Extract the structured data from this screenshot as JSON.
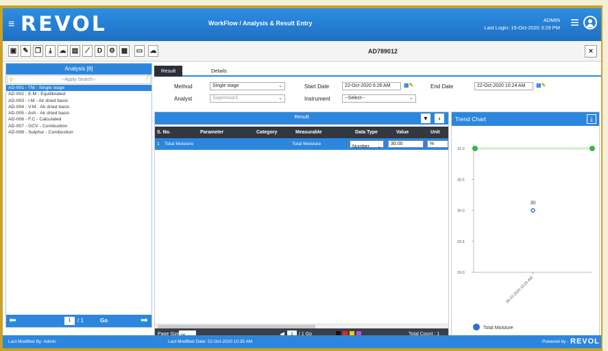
{
  "header": {
    "logo": "REVOL",
    "menu_icon": "hamburger-icon",
    "breadcrumb": "WorkFlow / Analysis & Result Entry",
    "user": "ADMIN",
    "last_login": "Last Login: 15-Oct-2020 3:29 PM"
  },
  "toolbar": {
    "icons": [
      "save-icon",
      "edit-icon",
      "copy-icon",
      "download-icon",
      "upload-icon",
      "document-icon",
      "chart-icon",
      "d-icon",
      "group-icon",
      "calculator-icon",
      "blank-doc-icon",
      "upload-cloud-icon"
    ],
    "d_label": "D",
    "sample_code": "AD789012",
    "close_label": "×"
  },
  "analysis_panel": {
    "title": "Analysis [8]",
    "search_placeholder": "--Apply Search--",
    "items": [
      "AD-001 - TM - Single stage",
      "AD-002 - E.M - Equilibrated",
      "AD-003 - I.M - Air dried basis",
      "AD-004 - V.M - Air dried basis",
      "AD-005 - Ash - Air dried basis",
      "AD-006 - F.C - Calculated",
      "AD-007 - GCV - Combustion",
      "AD-008 - Sulphur - Combustion"
    ],
    "selected_index": 0,
    "page": "1",
    "page_total": "/ 1",
    "go_label": "Go"
  },
  "tabs": [
    {
      "label": "Result",
      "active": true
    },
    {
      "label": "Details",
      "active": false
    }
  ],
  "form": {
    "method_label": "Method",
    "method_value": "Single stage",
    "analyst_label": "Analyst",
    "analyst_value": "Supervisor1",
    "start_label": "Start Date",
    "start_value": "22-Oct-2020 6:26 AM",
    "end_label": "End Date",
    "end_value": "22-Oct-2020 10:24 AM",
    "instrument_label": "Instrument",
    "instrument_value": "--Select--"
  },
  "result_grid": {
    "title": "Result",
    "columns": [
      "S. No.",
      "Parameter",
      "Category",
      "Measurable",
      "Data Type",
      "Value",
      "Unit"
    ],
    "rows": [
      {
        "sno": "1",
        "parameter": "Total Moisture",
        "category": "",
        "measurable": "Total Moisture",
        "data_type": "Number",
        "value": "30.00",
        "unit": "%"
      }
    ],
    "page_size_label": "Page Size :",
    "page_size": "25",
    "page": "1",
    "page_of": "/ 1 Go",
    "total_count": "Total Count : 1",
    "color_swatches": [
      "#111111",
      "#e8261c",
      "#ffcc00",
      "#c04ad8"
    ]
  },
  "trend_chart": {
    "title": "Trend Chart",
    "chart_data": {
      "type": "line",
      "ylim": [
        29.0,
        31.0
      ],
      "y_ticks": [
        "31.0",
        "30.5",
        "30.0",
        "29.5",
        "29.0"
      ],
      "categories": [
        "06-22-2020 10:24 AM"
      ],
      "series": [
        {
          "name": "Total Moisture",
          "values": [
            30
          ],
          "color": "#2d6fd0"
        }
      ],
      "point_label": "30",
      "limit_line": {
        "value": 31.0,
        "color": "#3ab54a"
      },
      "legend_position": "bottom-left"
    }
  },
  "statusbar": {
    "modified_by": "Last Modified By: Admin",
    "modified_date": "Last Modified Date: 22-Oct-2020 10:35 AM",
    "powered_by": "Powered by -",
    "powered_logo": "REVOL"
  }
}
